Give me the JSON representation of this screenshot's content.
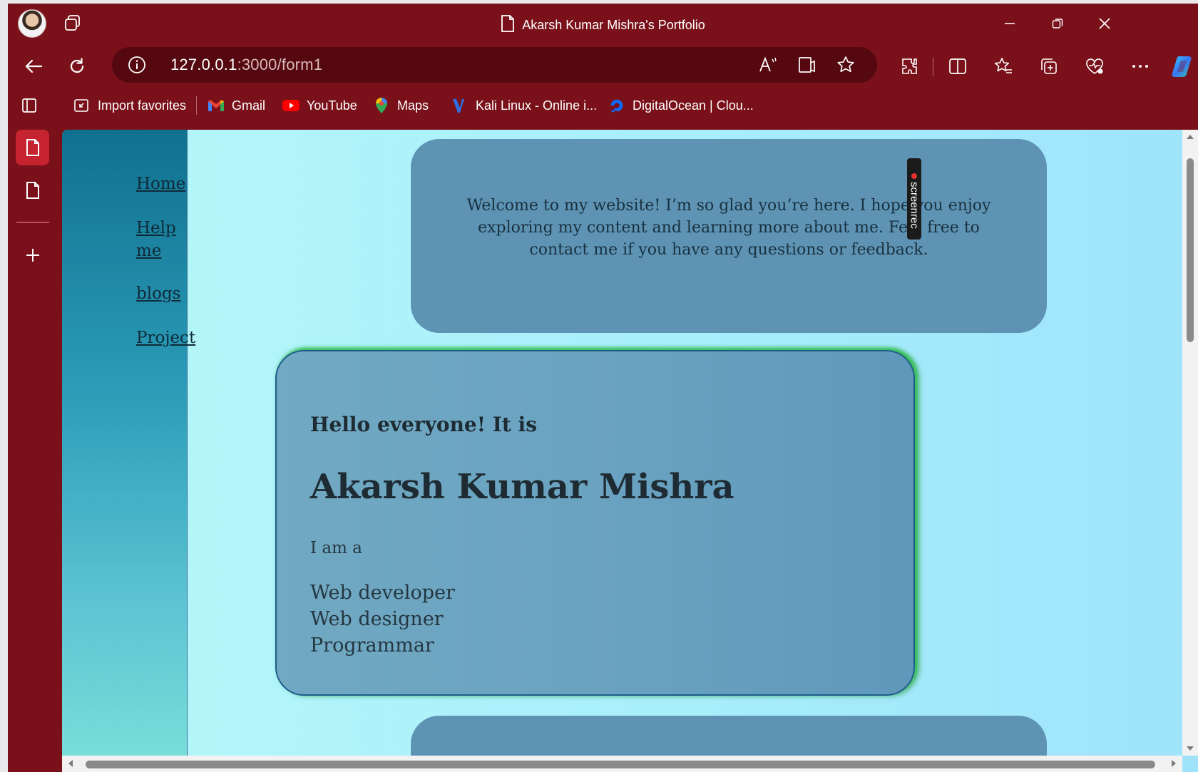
{
  "browser": {
    "tab_title": "Akarsh Kumar Mishra's Portfolio",
    "address": {
      "host": "127.0.0.1",
      "path": ":3000/form1"
    },
    "colors": {
      "frame": "#7a111a",
      "address_bg": "#55080f",
      "active_tab": "#c4232f"
    }
  },
  "favorites": [
    {
      "label": "Import favorites",
      "icon": "import-icon"
    },
    {
      "label": "Gmail",
      "icon": "gmail-icon"
    },
    {
      "label": "YouTube",
      "icon": "youtube-icon"
    },
    {
      "label": "Maps",
      "icon": "maps-pin-icon"
    },
    {
      "label": "Kali Linux - Online i...",
      "icon": "kali-icon"
    },
    {
      "label": "DigitalOcean | Clou...",
      "icon": "digitalocean-icon"
    }
  ],
  "site": {
    "nav": [
      {
        "label": "Home"
      },
      {
        "label_line1": "Help",
        "label_line2": "me"
      },
      {
        "label": "blogs"
      },
      {
        "label": "Project"
      }
    ],
    "welcome_text": "Welcome to my website! I’m so glad you’re here. I hope you enjoy exploring my content and learning more about me. Feel free to contact me if you have any questions or feedback.",
    "hero": {
      "greeting": "Hello everyone! It is",
      "name": "Akarsh Kumar Mishra",
      "intro": "I am a",
      "roles": [
        "Web developer",
        "Web designer",
        "Programmar"
      ]
    },
    "overlay_badge": "screenrec"
  }
}
